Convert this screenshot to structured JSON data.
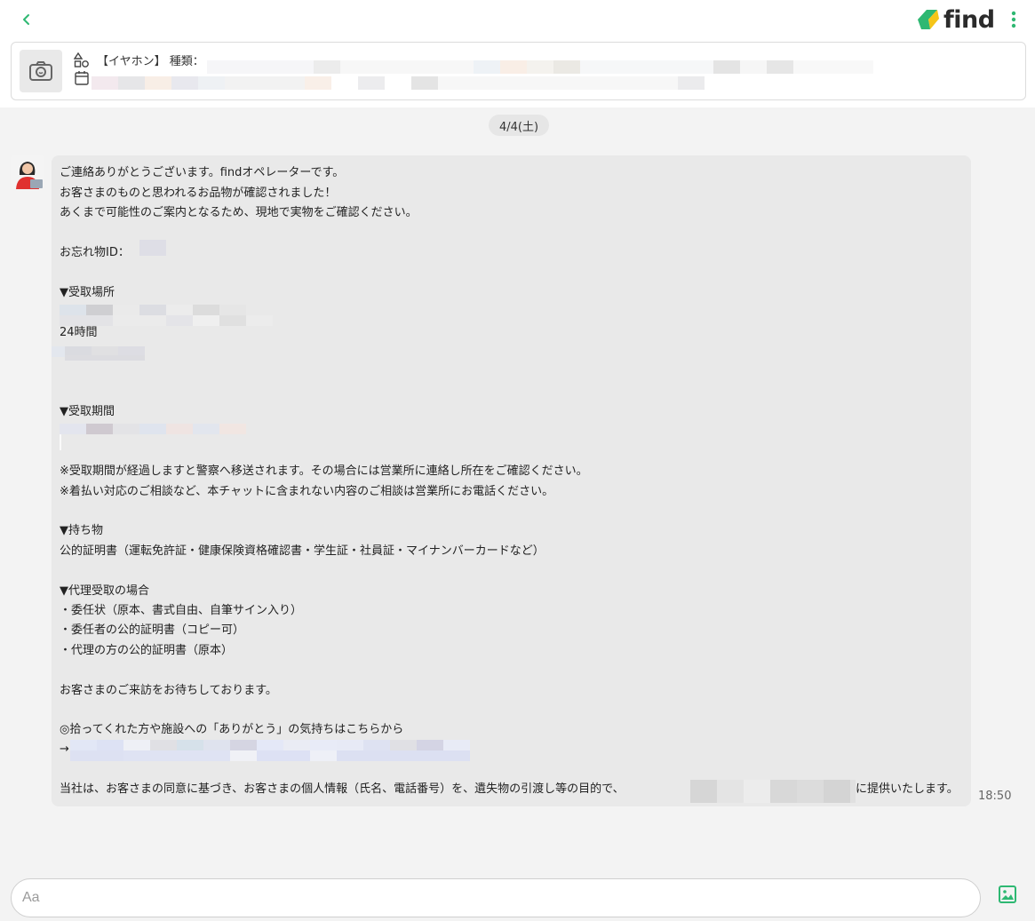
{
  "header": {
    "logo_text": "find",
    "accent_color": "#2eb872",
    "logo_yellow": "#f5c518",
    "back_icon": "chevron-left-icon",
    "menu_icon": "vertical-dots-icon"
  },
  "item": {
    "category_line": "【イヤホン】 種類：",
    "photo_icon": "camera-icon",
    "category_icon": "shapes-icon",
    "date_icon": "calendar-icon"
  },
  "chat": {
    "date": "4/4(土)",
    "time": "18:50",
    "lines": {
      "greeting": "ご連絡ありがとうございます。findオペレーターです。",
      "found": "お客さまのものと思われるお品物が確認されました！",
      "notice": "あくまで可能性のご案内となるため、現地で実物をご確認ください。",
      "lost_id": "お忘れ物ID：",
      "place_head": "▼受取場所",
      "hours": "24時間",
      "period_head": "▼受取期間",
      "police_note": "※受取期間が経過しますと警察へ移送されます。その場合には営業所に連絡し所在をご確認ください。",
      "other_note": "※着払い対応のご相談など、本チャットに含まれない内容のご相談は営業所にお電話ください。",
      "items_head": "▼持ち物",
      "id_docs": "公的証明書（運転免許証・健康保険資格確認書・学生証・社員証・マイナンバーカードなど）",
      "proxy_head": "▼代理受取の場合",
      "proxy_1": "・委任状（原本、書式自由、自筆サイン入り）",
      "proxy_2": "・委任者の公的証明書（コピー可）",
      "proxy_3": "・代理の方の公的証明書（原本）",
      "closing": "お客さまのご来訪をお待ちしております。",
      "thanks": "◎拾ってくれた方や施設への「ありがとう」の気持ちはこちらから",
      "arrow": "→",
      "privacy_a": "当社は、お客さまの同意に基づき、お客さまの個人情報（氏名、電話番号）を、遺失物の引渡し等の目的で、",
      "privacy_b": "に提供いたします。"
    }
  },
  "composer": {
    "placeholder": "Aa",
    "image_icon": "image-icon"
  }
}
